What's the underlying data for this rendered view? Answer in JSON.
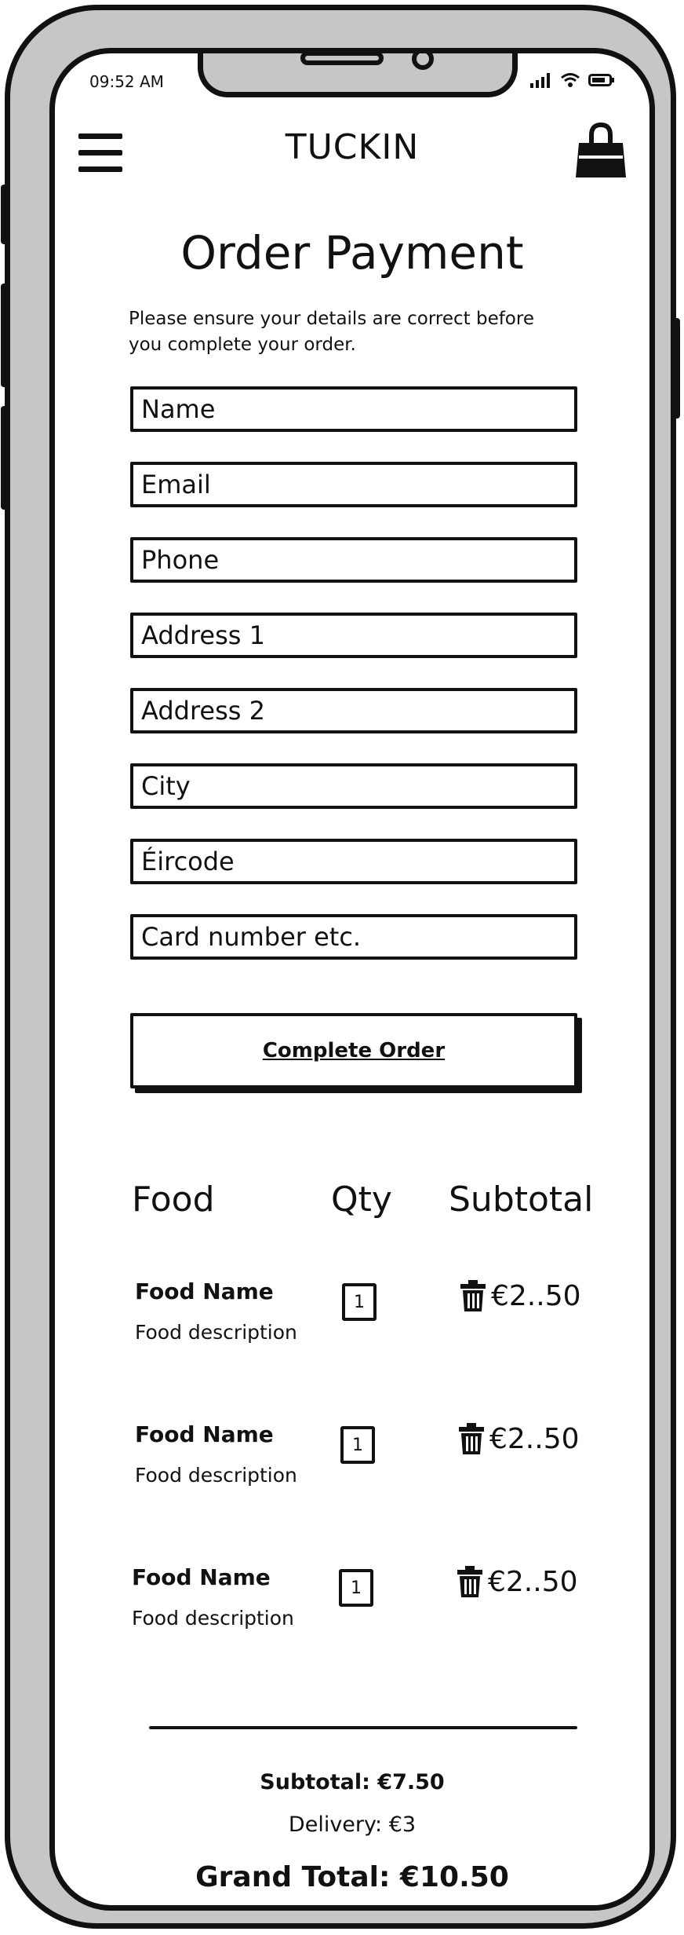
{
  "status_bar": {
    "time": "09:52 AM",
    "icons": [
      "signal-icon",
      "wifi-icon",
      "battery-icon"
    ]
  },
  "header": {
    "brand": "TUCKIN",
    "menu_icon": "hamburger-menu-icon",
    "cart_icon": "shopping-bag-icon"
  },
  "page": {
    "title": "Order Payment",
    "intro_line1": "Please ensure your details are correct before",
    "intro_line2": "you complete your order."
  },
  "form": {
    "fields": [
      {
        "placeholder": "Name"
      },
      {
        "placeholder": "Email"
      },
      {
        "placeholder": "Phone"
      },
      {
        "placeholder": "Address 1"
      },
      {
        "placeholder": "Address 2"
      },
      {
        "placeholder": "City"
      },
      {
        "placeholder": "Éircode"
      },
      {
        "placeholder": "Card number etc."
      }
    ],
    "submit_label": "Complete Order"
  },
  "order_table": {
    "headers": {
      "food": "Food",
      "qty": "Qty",
      "subtotal": "Subtotal"
    },
    "items": [
      {
        "name": "Food Name",
        "description": "Food description",
        "qty": "1",
        "price": "€2..50"
      },
      {
        "name": "Food Name",
        "description": "Food description",
        "qty": "1",
        "price": "€2..50"
      },
      {
        "name": "Food Name",
        "description": "Food description",
        "qty": "1",
        "price": "€2..50"
      }
    ]
  },
  "totals": {
    "subtotal": "Subtotal: €7.50",
    "delivery": "Delivery: €3",
    "grand_total": "Grand Total: €10.50"
  },
  "colors": {
    "frame": "#c6c6c6",
    "ink": "#111111",
    "screen": "#ffffff"
  }
}
